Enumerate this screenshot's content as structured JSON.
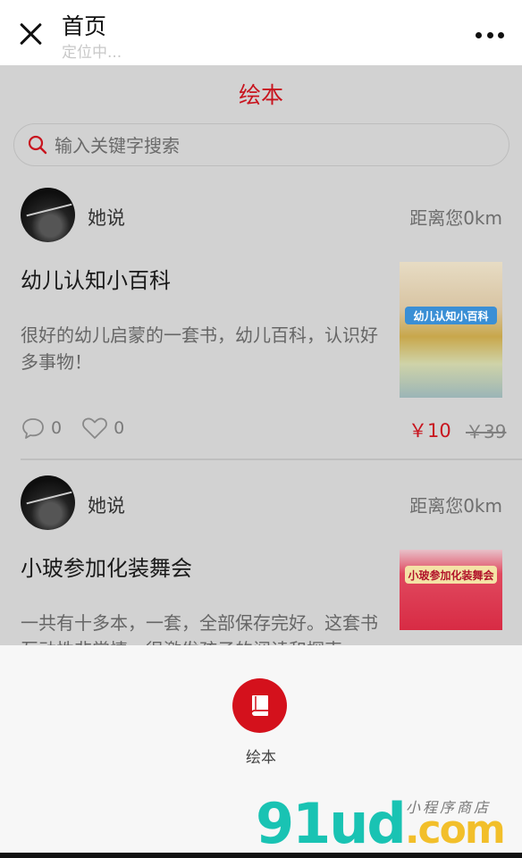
{
  "nav": {
    "title": "首页",
    "subtitle": "定位中..."
  },
  "category_title": "绘本",
  "search": {
    "placeholder": "输入关键字搜索"
  },
  "listings": [
    {
      "user": "她说",
      "distance": "距离您0km",
      "title": "幼儿认知小百科",
      "description": "很好的幼儿启蒙的一套书，幼儿百科，认识好多事物！",
      "cover_text": "幼儿认知小百科",
      "comments": "0",
      "likes": "0",
      "price": "￥10",
      "original_price": "￥39"
    },
    {
      "user": "她说",
      "distance": "距离您0km",
      "title": "小玻参加化装舞会",
      "description": "一共有十多本，一套，全部保存完好。这套书互动性非常情，很激发孩子的阅读和探索",
      "cover_text": "小玻参加化装舞会"
    }
  ],
  "sheet": {
    "item_label": "绘本"
  },
  "watermark": {
    "brand": "91ud",
    "suffix": ".com",
    "tag": "小程序商店"
  },
  "colors": {
    "accent": "#c8141e",
    "overlay_bg": "#d2d2d2",
    "sheet_bg": "#f7f7f7"
  }
}
